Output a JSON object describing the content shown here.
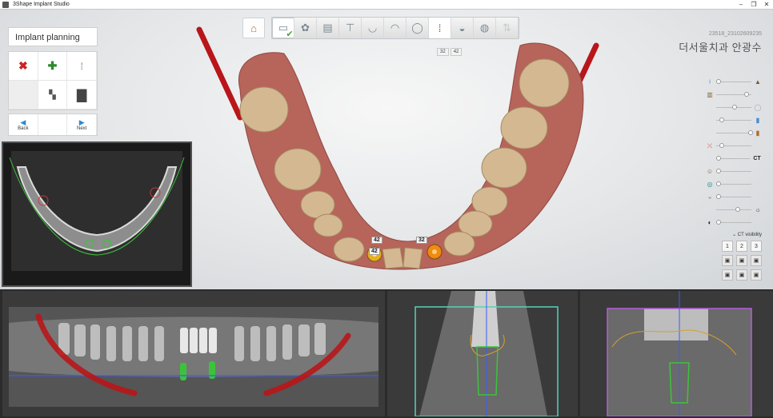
{
  "app": {
    "title": "3Shape Implant Studio"
  },
  "toolbar": {
    "tools": [
      {
        "name": "home-icon"
      },
      {
        "name": "scan-icon"
      },
      {
        "name": "tooth-setup-icon"
      },
      {
        "name": "ct-icon"
      },
      {
        "name": "alignment-icon"
      },
      {
        "name": "nerve-icon"
      },
      {
        "name": "crown-icon"
      },
      {
        "name": "wax-icon"
      },
      {
        "name": "implant-icon"
      },
      {
        "name": "sleeve-icon"
      },
      {
        "name": "guide-icon"
      },
      {
        "name": "export-icon"
      }
    ],
    "subtabs": [
      "32",
      "42"
    ]
  },
  "case": {
    "id": "23518_23102609235",
    "patient": "더서울치과 안광수"
  },
  "left_panel": {
    "title": "Implant planning",
    "back_label": "Back",
    "next_label": "Next"
  },
  "visibility": {
    "ct_label": "CT",
    "ct_visibility_label": "CT visibility",
    "view_buttons": [
      "1",
      "2",
      "3"
    ]
  },
  "implants": {
    "tag_upper": "42",
    "tag_lower": "42",
    "tag_right": "32"
  },
  "colors": {
    "pin": "#b8161a",
    "gingiva": "#b7645a",
    "tooth": "#d9c2a0",
    "implant_gold": "#e8b020",
    "implant_orange": "#f08a10",
    "nerve_green": "#3bc43b",
    "cross_teal": "#56d1b8",
    "cross_purple": "#b55cd8",
    "axis_blue": "#3a5cff"
  }
}
